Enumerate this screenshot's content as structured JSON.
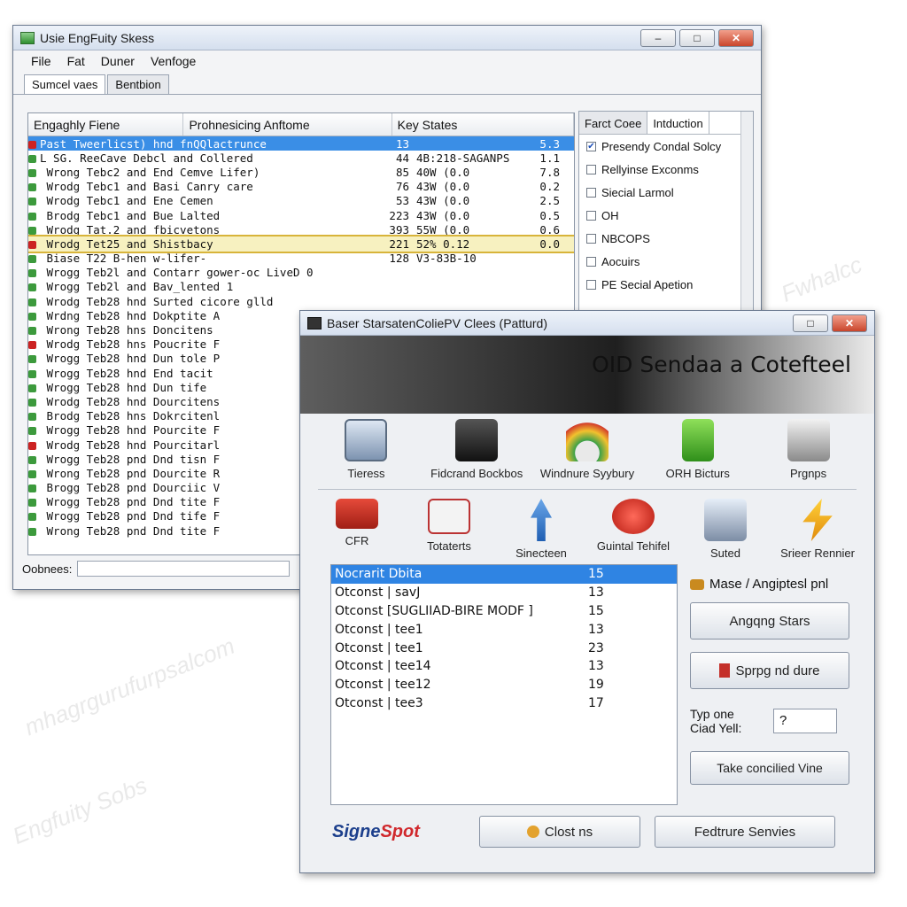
{
  "winA": {
    "title": "Usie EngFuity Skess",
    "menu": [
      "File",
      "Fat",
      "Duner",
      "Venfoge"
    ],
    "tabs": [
      "Sumcel vaes",
      "Bentbion"
    ],
    "columns": [
      "Engaghly Fiene",
      "Prohnesicing Anftome",
      "Key States"
    ],
    "rows": [
      {
        "name": "Past Tweerlicst) hnd fnQQlactrunce",
        "v1": "13",
        "v2": "",
        "v3": "5.3",
        "state": "sel"
      },
      {
        "name": "L SG. ReeCave Debcl and Collered",
        "v1": "44",
        "v2": "4B:218-SAGANPS",
        "v3": "1.1"
      },
      {
        "name": "  Wrong Tebc2 and End Cemve Lifer)",
        "v1": "85",
        "v2": "40W (0.0",
        "v3": "7.8"
      },
      {
        "name": "  Wrodg Tebc1 and Basi Canry care",
        "v1": "76",
        "v2": "43W (0.0",
        "v3": "0.2"
      },
      {
        "name": "  Wrodg Tebc1 and Ene Cemen",
        "v1": "53",
        "v2": "43W (0.0",
        "v3": "2.5"
      },
      {
        "name": "  Brodg Tebc1 and Bue Lalted",
        "v1": "223",
        "v2": "43W (0.0",
        "v3": "0.5"
      },
      {
        "name": "  Wrodg Tat.2 and fbicvetons",
        "v1": "393",
        "v2": "55W (0.0",
        "v3": "0.6"
      },
      {
        "name": "  Wrodg Tet25 and Shistbacy",
        "v1": "221",
        "v2": "52% 0.12",
        "v3": "0.0",
        "state": "hl"
      },
      {
        "name": "    Biase T22 B-hen w-lifer-",
        "v1": "128",
        "v2": "V3-83B-10",
        "v3": ""
      },
      {
        "name": "  Wrogg Teb2l and Contarr gower-oc LiveD 0",
        "v1": "",
        "v2": "",
        "v3": ""
      },
      {
        "name": "  Wrogg Teb2l and Bav_lented 1",
        "v1": "",
        "v2": "",
        "v3": ""
      },
      {
        "name": "  Wrodg Teb28 hnd Surted cicore glld",
        "v1": "",
        "v2": "",
        "v3": ""
      },
      {
        "name": "  Wrdng Teb28 hnd Dokptite A",
        "v1": "",
        "v2": "",
        "v3": ""
      },
      {
        "name": "  Wrong Teb28 hns Doncitens",
        "v1": "",
        "v2": "",
        "v3": ""
      },
      {
        "name": "  Wrodg Teb28 hns Poucrite F",
        "v1": "",
        "v2": "",
        "v3": ""
      },
      {
        "name": "  Wrogg Teb28 hnd Dun tole P",
        "v1": "",
        "v2": "",
        "v3": ""
      },
      {
        "name": "  Wrogg Teb28 hnd End tacit",
        "v1": "",
        "v2": "",
        "v3": ""
      },
      {
        "name": "  Wrogg Teb28 hnd Dun tife",
        "v1": "",
        "v2": "",
        "v3": ""
      },
      {
        "name": "  Wrodg Teb28 hnd Dourcitens",
        "v1": "",
        "v2": "",
        "v3": ""
      },
      {
        "name": "  Brodg Teb28 hns Dokrcitenl",
        "v1": "",
        "v2": "",
        "v3": ""
      },
      {
        "name": "  Wrogg Teb28 hnd Pourcite F",
        "v1": "",
        "v2": "",
        "v3": ""
      },
      {
        "name": "  Wrodg Teb28 hnd Pourcitarl",
        "v1": "",
        "v2": "",
        "v3": ""
      },
      {
        "name": "  Wrogg Teb28 pnd Dnd tisn F",
        "v1": "",
        "v2": "",
        "v3": ""
      },
      {
        "name": "  Wrong Teb28 pnd Dourcite R",
        "v1": "",
        "v2": "",
        "v3": ""
      },
      {
        "name": "  Brogg Teb28 pnd Dourciic V",
        "v1": "",
        "v2": "",
        "v3": ""
      },
      {
        "name": "  Wrogg Teb28 pnd Dnd tite F",
        "v1": "",
        "v2": "",
        "v3": ""
      },
      {
        "name": "  Wrogg Teb28 pnd Dnd tife F",
        "v1": "",
        "v2": "",
        "v3": ""
      },
      {
        "name": "  Wrong Teb28 pnd Dnd tite F",
        "v1": "",
        "v2": "",
        "v3": ""
      }
    ],
    "status_label": "Oobnees:",
    "side": {
      "tabs": [
        "Farct Coee",
        "Intduction"
      ],
      "items": [
        {
          "label": "Presendy Condal Solcy",
          "checked": "✔"
        },
        {
          "label": "Rellyinse Exconms",
          "checked": ""
        },
        {
          "label": "Siecial Larmol",
          "checked": ""
        },
        {
          "label": "OH",
          "checked": ""
        },
        {
          "label": "NBCOPS",
          "checked": ""
        },
        {
          "label": "Aocuirs",
          "checked": ""
        },
        {
          "label": "PE Secial Apetion",
          "checked": ""
        }
      ]
    }
  },
  "winB": {
    "title": "Baser StarsatenColiePV Clees (Patturd)",
    "banner": "OID Sendaa a Cotefteel",
    "icons_row1": [
      {
        "label": "Tieress",
        "icon": "monitor-icon"
      },
      {
        "label": "Fidcrand Bockbos",
        "icon": "tower-icon"
      },
      {
        "label": "Windnure Syybury",
        "icon": "gauge-icon"
      },
      {
        "label": "ORH Bicturs",
        "icon": "battery-icon"
      },
      {
        "label": "Prgnps",
        "icon": "tools-icon"
      }
    ],
    "icons_row2": [
      {
        "label": "CFR",
        "icon": "check-icon"
      },
      {
        "label": "Totaterts",
        "icon": "chart-icon"
      },
      {
        "label": "Sinecteen",
        "icon": "arrow-icon"
      },
      {
        "label": "Guintal Tehifel",
        "icon": "red-button-icon"
      },
      {
        "label": "Suted",
        "icon": "cash-register-icon"
      },
      {
        "label": "Srieer Rennier",
        "icon": "bolt-icon"
      }
    ],
    "list": [
      {
        "name": "Nocrarit Dbita",
        "value": "15"
      },
      {
        "name": "Otconst | savJ",
        "value": "13"
      },
      {
        "name": "Otconst [SUGLIIAD-BIRE MODF ]",
        "value": "15"
      },
      {
        "name": "Otconst | tee1",
        "value": "13"
      },
      {
        "name": "Otconst | tee1",
        "value": "23"
      },
      {
        "name": "Otconst | tee14",
        "value": "13"
      },
      {
        "name": "Otconst | tee12",
        "value": "19"
      },
      {
        "name": "Otconst | tee3",
        "value": "17"
      }
    ],
    "right_label": "Mase / Angiptesl pnl",
    "btn1": "Angqng Stars",
    "btn2": "Sprpg nd dure",
    "type_label": "Typ one\nCiad Yell:",
    "type_value": "?",
    "btn3": "Take concilied Vine",
    "logo_a": "Signe",
    "logo_b": "Spot",
    "close_label": "Clost ns",
    "feature_label": "Fedtrure Senvies"
  }
}
